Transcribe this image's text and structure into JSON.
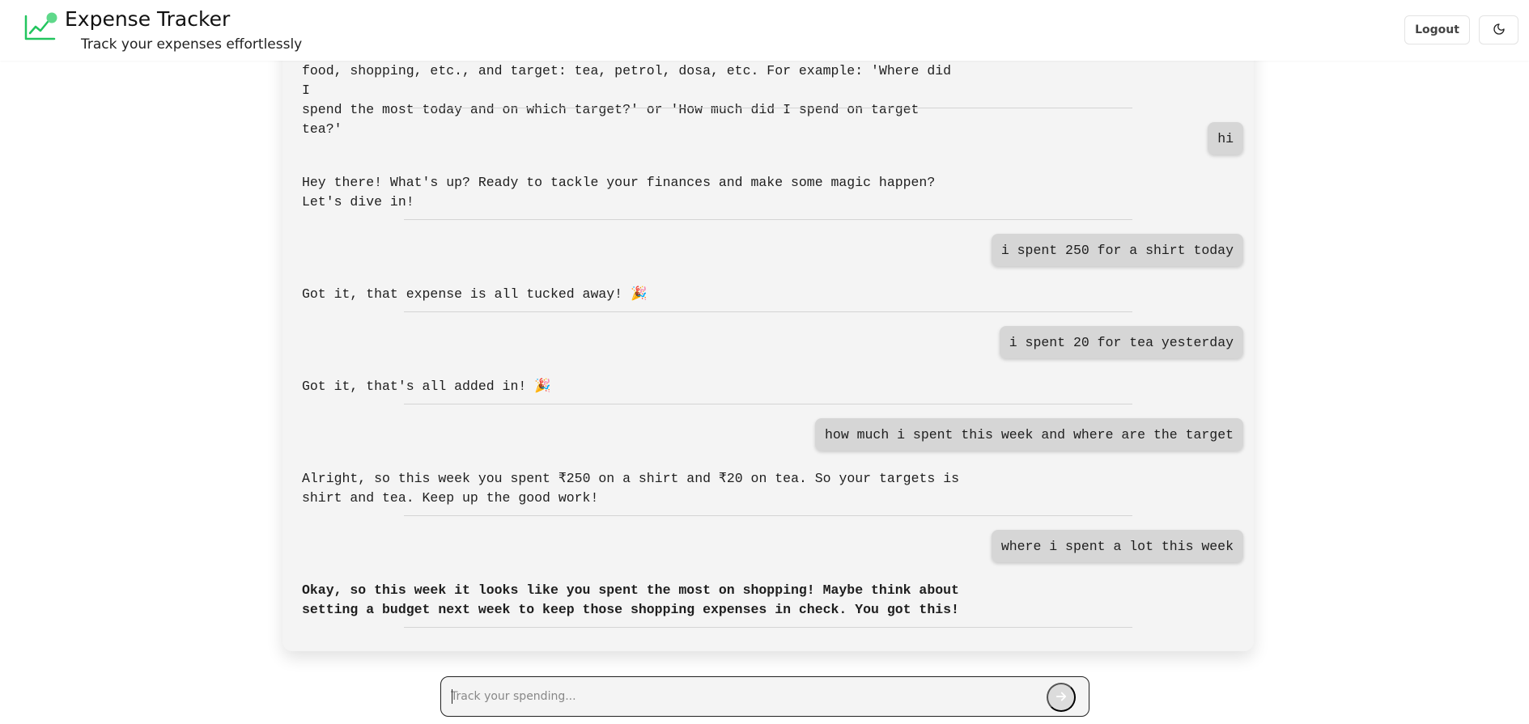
{
  "header": {
    "title": "Expense Tracker",
    "subtitle": "Track your expenses effortlessly",
    "logout_label": "Logout",
    "logo_icon": "trending-up-chart-icon",
    "theme_icon": "moon-icon",
    "accent_color": "#22c55e"
  },
  "chat": {
    "messages": [
      {
        "role": "bot",
        "text": "food, shopping, etc., and target: tea, petrol, dosa, etc. For example: 'Where did I\nspend the most today and on which target?' or 'How much did I spend on target tea?'"
      },
      {
        "role": "user",
        "text": "hi"
      },
      {
        "role": "bot",
        "text": "Hey there! What's up? Ready to tackle your finances and make some magic happen?\nLet's dive in!"
      },
      {
        "role": "user",
        "text": "i spent 250 for a shirt today"
      },
      {
        "role": "bot",
        "text": "Got it, that expense is all tucked away! 🎉"
      },
      {
        "role": "user",
        "text": "i spent 20 for tea yesterday"
      },
      {
        "role": "bot",
        "text": "Got it, that's all added in! 🎉"
      },
      {
        "role": "user",
        "text": "how much i spent this week and where are the target"
      },
      {
        "role": "bot",
        "text": "Alright, so this week you spent ₹250 on a shirt and ₹20 on tea. So your targets is\nshirt and tea. Keep up the good work!"
      },
      {
        "role": "user",
        "text": "where i spent a lot this week"
      },
      {
        "role": "bot",
        "text": "Okay, so this week it looks like you spent the most on shopping! Maybe think about\nsetting a budget next week to keep those shopping expenses in check. You got this!"
      }
    ]
  },
  "composer": {
    "placeholder": "Track your spending...",
    "value": "",
    "send_icon": "arrow-right-icon"
  }
}
